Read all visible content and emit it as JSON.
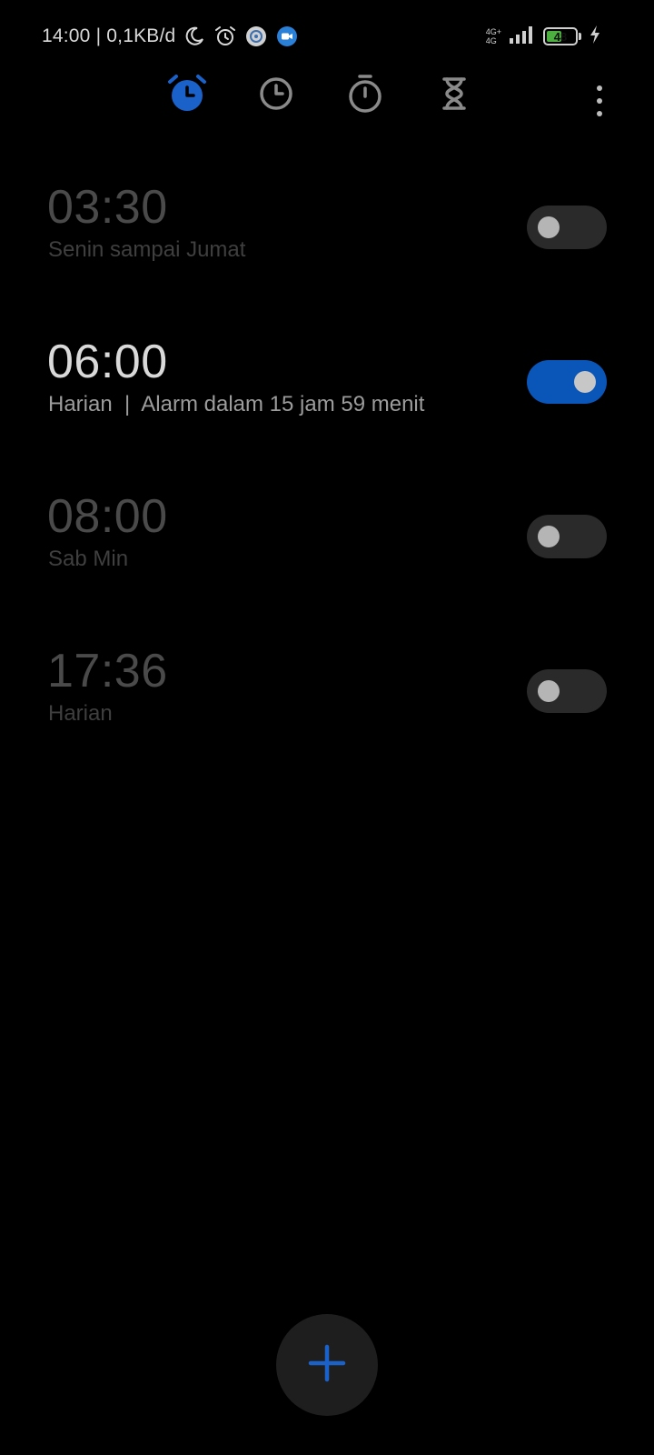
{
  "status_bar": {
    "time_data": "14:00 | 0,1KB/d",
    "network_top": "4G+",
    "network_bottom": "4G",
    "battery_level": "48",
    "icons": [
      "moon-icon",
      "alarm-status-icon",
      "app-notification-icon",
      "video-call-icon",
      "signal-icon",
      "battery-icon",
      "charging-bolt-icon"
    ]
  },
  "tabs": [
    {
      "id": "alarm",
      "icon": "alarm-clock-icon",
      "active": true
    },
    {
      "id": "world-clock",
      "icon": "clock-icon",
      "active": false
    },
    {
      "id": "stopwatch",
      "icon": "stopwatch-icon",
      "active": false
    },
    {
      "id": "timer",
      "icon": "hourglass-icon",
      "active": false
    }
  ],
  "alarms": [
    {
      "time": "03:30",
      "description": "Senin sampai Jumat",
      "enabled": false
    },
    {
      "time": "06:00",
      "description": "Harian  |  Alarm dalam 15 jam 59 menit",
      "enabled": true
    },
    {
      "time": "08:00",
      "description": "Sab Min",
      "enabled": false
    },
    {
      "time": "17:36",
      "description": "Harian",
      "enabled": false
    }
  ],
  "colors": {
    "accent": "#1a62c9",
    "toggle_on": "#0a55b8",
    "background": "#000000"
  },
  "fab": {
    "icon": "plus-icon"
  }
}
